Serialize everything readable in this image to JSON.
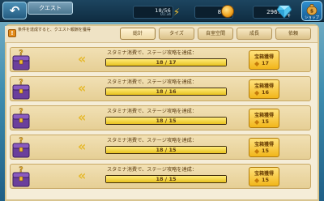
{
  "header": {
    "tab_title": "クエスト",
    "stamina": "18/56",
    "stamina_timer": "01:34",
    "gold": "830",
    "gems": "2967",
    "shop_label": "ショップ"
  },
  "notice": {
    "text": "条件を達成すると、クエスト報酬を獲得"
  },
  "tabs": [
    {
      "label": "総計",
      "active": true
    },
    {
      "label": "タイズ",
      "active": false
    },
    {
      "label": "自室空間",
      "active": false
    },
    {
      "label": "成長",
      "active": false
    },
    {
      "label": "依頼",
      "active": false
    }
  ],
  "quests": [
    {
      "description": "スタミナ消費で、ステージ攻略を達成：",
      "progress_text": "18 / 17",
      "reward_label": "宝箱獲得",
      "reward_count": "17",
      "progress": 1.0
    },
    {
      "description": "スタミナ消費で、ステージ攻略を達成：",
      "progress_text": "18 / 16",
      "reward_label": "宝箱獲得",
      "reward_count": "16",
      "progress": 1.0
    },
    {
      "description": "スタミナ消費で、ステージ攻略を達成：",
      "progress_text": "18 / 15",
      "reward_label": "宝箱獲得",
      "reward_count": "15",
      "progress": 1.0
    },
    {
      "description": "スタミナ消費で、ステージ攻略を達成：",
      "progress_text": "18 / 15",
      "reward_label": "宝箱獲得",
      "reward_count": "15",
      "progress": 1.0
    },
    {
      "description": "スタミナ消費で、ステージ攻略を達成：",
      "progress_text": "18 / 15",
      "reward_label": "宝箱獲得",
      "reward_count": "15",
      "progress": 1.0
    }
  ],
  "icons": {
    "back": "back-arrow-icon",
    "stamina": "lightning-icon",
    "gold": "gold-coin-icon",
    "gems": "gem-icon",
    "shop": "money-bag-icon",
    "notice": "notice-icon",
    "quest": "treasure-chest-icon",
    "reward": "ticket-icon"
  },
  "colors": {
    "accent": "#f2b61a",
    "panel": "#f5edd8",
    "header_bg": "#0f2d42"
  }
}
